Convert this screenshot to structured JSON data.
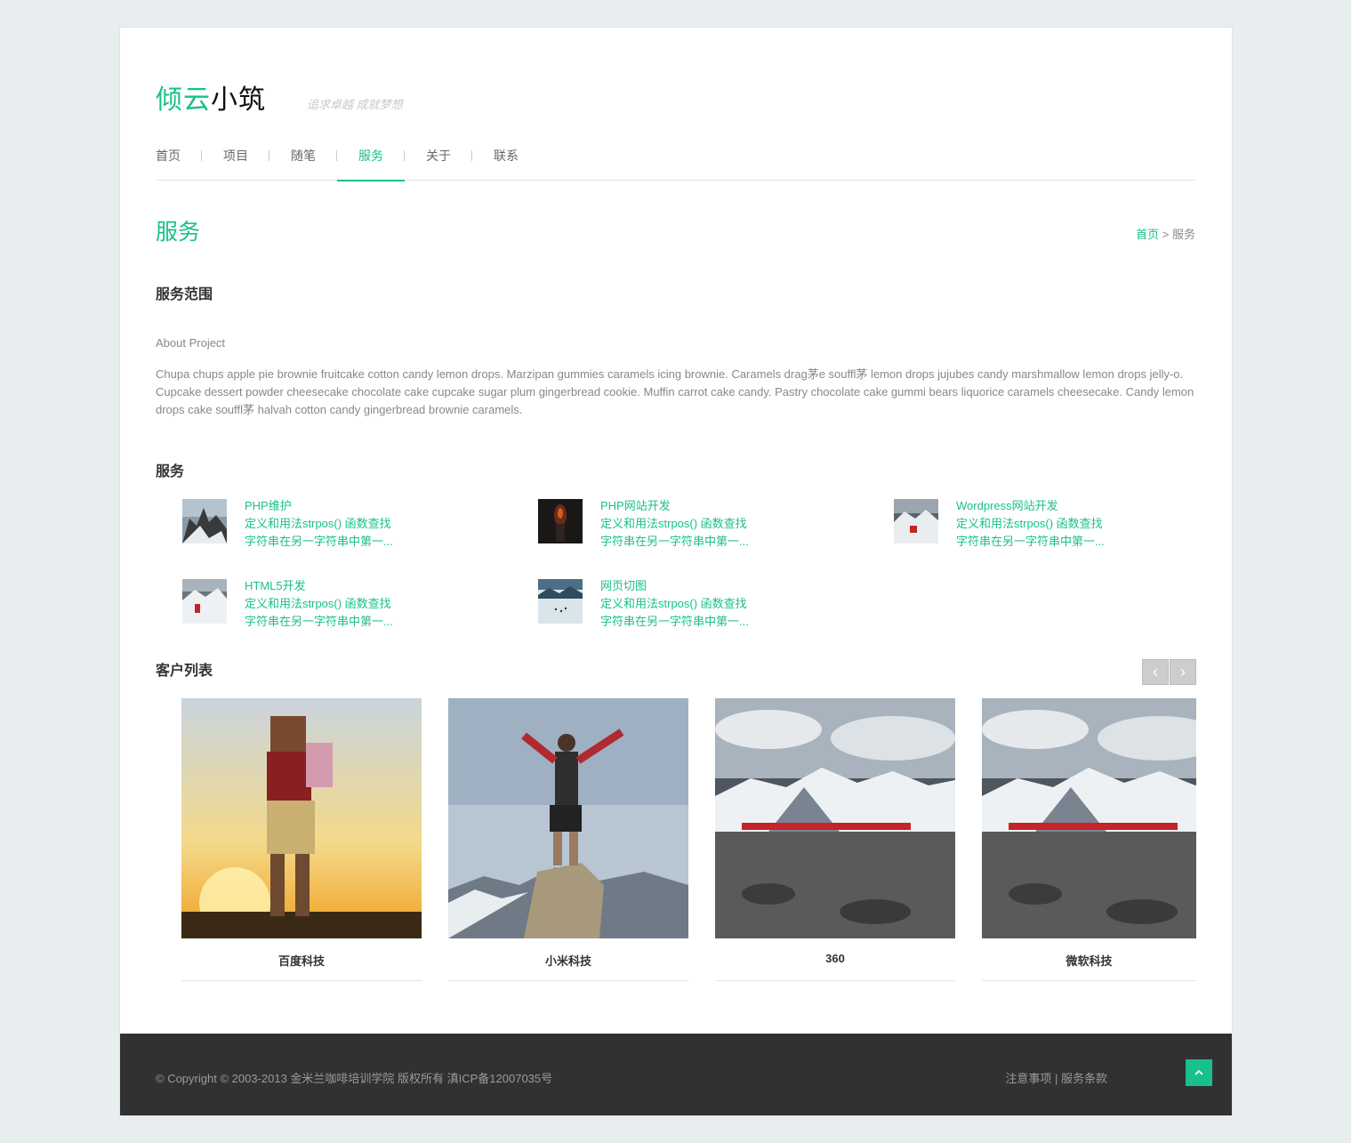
{
  "header": {
    "logo_part1": "倾云",
    "logo_part2": "小筑",
    "slogan": "追求卓越 成就梦想"
  },
  "nav": [
    {
      "label": "首页"
    },
    {
      "label": "项目"
    },
    {
      "label": "随笔"
    },
    {
      "label": "服务"
    },
    {
      "label": "关于"
    },
    {
      "label": "联系"
    }
  ],
  "page": {
    "title": "服务",
    "breadcrumb_home": "首页",
    "breadcrumb_sep": " > ",
    "breadcrumb_current": "服务"
  },
  "scope": {
    "heading": "服务范围",
    "label": "About Project",
    "text": "Chupa chups apple pie brownie fruitcake cotton candy lemon drops. Marzipan gummies caramels icing brownie. Caramels drag茅e souffl茅 lemon drops jujubes candy marshmallow lemon drops jelly-o. Cupcake dessert powder cheesecake chocolate cake cupcake sugar plum gingerbread cookie. Muffin carrot cake candy. Pastry chocolate cake gummi bears liquorice caramels cheesecake. Candy lemon drops cake souffl茅 halvah cotton candy gingerbread brownie caramels."
  },
  "services": {
    "heading": "服务",
    "items": [
      {
        "title": "PHP维护",
        "line1": "定义和用法strpos() 函数查找",
        "line2": "字符串在另一字符串中第一..."
      },
      {
        "title": "PHP网站开发",
        "line1": "定义和用法strpos() 函数查找",
        "line2": "字符串在另一字符串中第一..."
      },
      {
        "title": "Wordpress网站开发",
        "line1": "定义和用法strpos() 函数查找",
        "line2": "字符串在另一字符串中第一..."
      },
      {
        "title": "HTML5开发",
        "line1": "定义和用法strpos() 函数查找",
        "line2": "字符串在另一字符串中第一..."
      },
      {
        "title": "网页切图",
        "line1": "定义和用法strpos() 函数查找",
        "line2": "字符串在另一字符串中第一..."
      }
    ]
  },
  "clients": {
    "heading": "客户列表",
    "prev": "‹",
    "next": "›",
    "items": [
      {
        "name": "百度科技"
      },
      {
        "name": "小米科技"
      },
      {
        "name": "360"
      },
      {
        "name": "微软科技"
      }
    ]
  },
  "footer": {
    "copyright": "© Copyright © 2003-2013 金米兰咖啡培训学院 版权所有 滇ICP备12007035号",
    "link1": "注意事项",
    "link_sep": " | ",
    "link2": "服务条款",
    "top_icon": "chevron-up-icon"
  },
  "colors": {
    "accent": "#19c08c",
    "footer_bg": "#313131",
    "page_bg": "#e8edf0"
  }
}
